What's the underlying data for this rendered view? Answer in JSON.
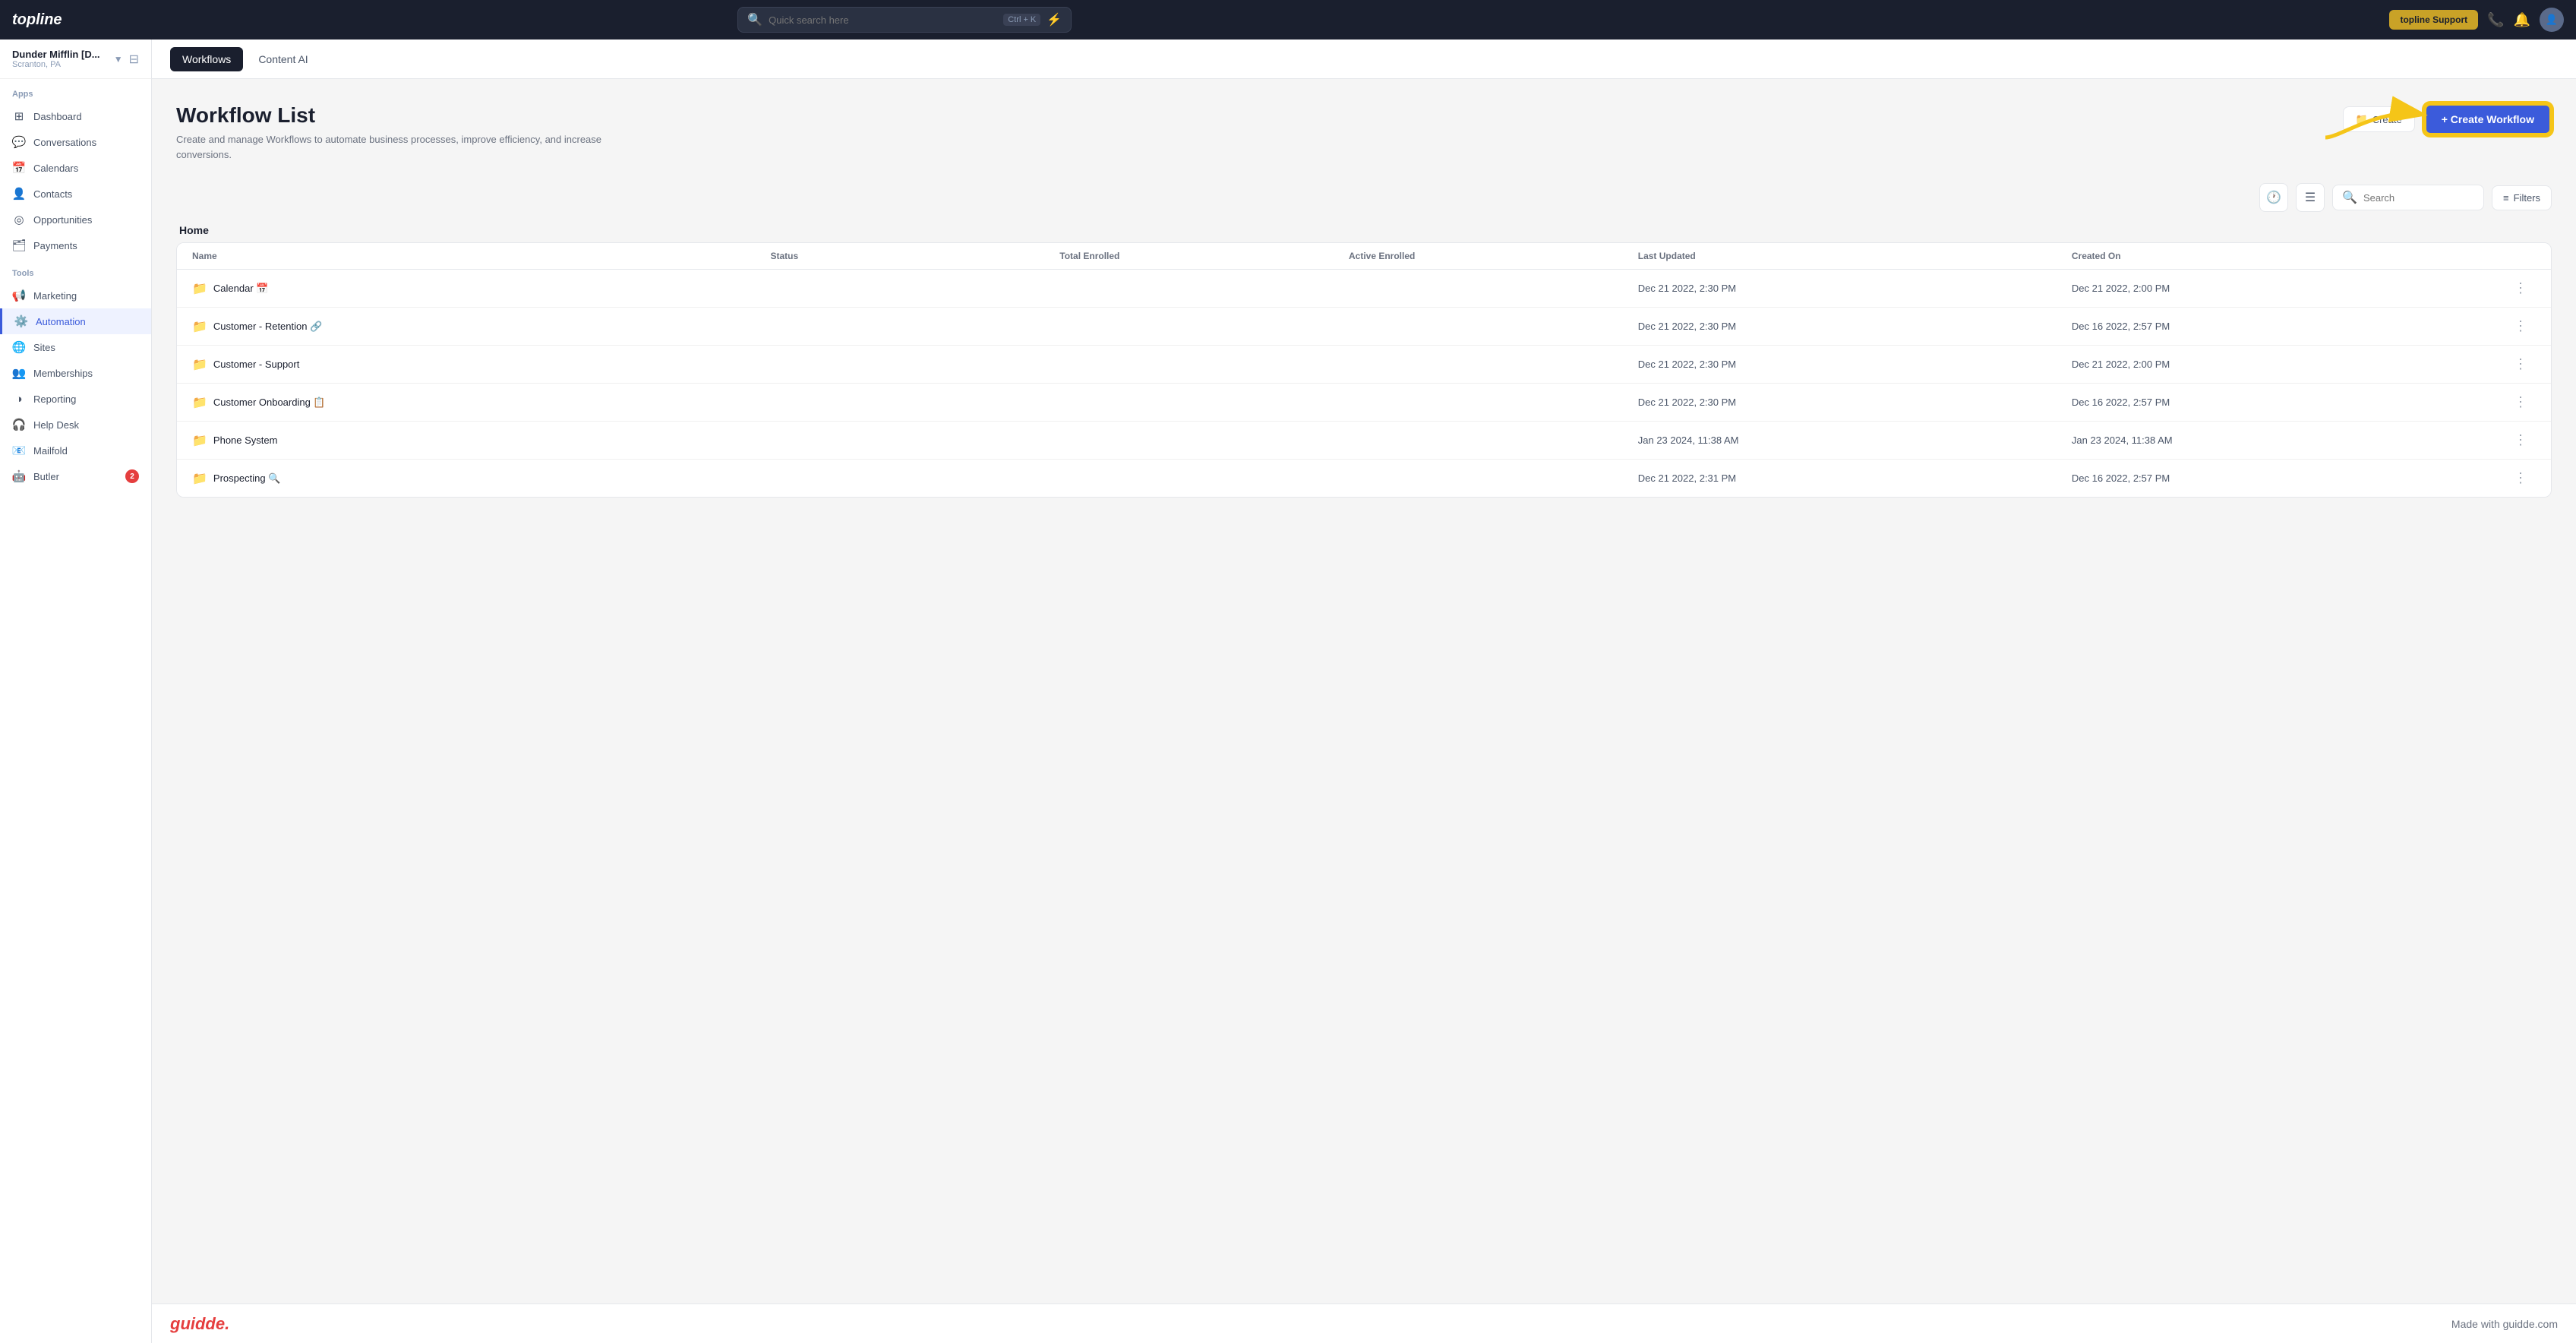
{
  "app": {
    "logo": "topline",
    "search_placeholder": "Quick search here",
    "search_shortcut": "Ctrl + K",
    "lightning_icon": "⚡",
    "support_label": "topline Support"
  },
  "sidebar": {
    "workspace_name": "Dunder Mifflin [D...",
    "workspace_location": "Scranton, PA",
    "apps_label": "Apps",
    "tools_label": "Tools",
    "items_apps": [
      {
        "id": "dashboard",
        "label": "Dashboard",
        "icon": "⊞"
      },
      {
        "id": "conversations",
        "label": "Conversations",
        "icon": "💬"
      },
      {
        "id": "calendars",
        "label": "Calendars",
        "icon": "📅"
      },
      {
        "id": "contacts",
        "label": "Contacts",
        "icon": "👤"
      },
      {
        "id": "opportunities",
        "label": "Opportunities",
        "icon": "◎"
      },
      {
        "id": "payments",
        "label": "Payments",
        "icon": "🗂"
      }
    ],
    "items_tools": [
      {
        "id": "marketing",
        "label": "Marketing",
        "icon": "📢"
      },
      {
        "id": "automation",
        "label": "Automation",
        "icon": "⚙",
        "active": true
      },
      {
        "id": "sites",
        "label": "Sites",
        "icon": "🌐"
      },
      {
        "id": "memberships",
        "label": "Memberships",
        "icon": "👥"
      },
      {
        "id": "reporting",
        "label": "Reporting",
        "icon": "◑"
      },
      {
        "id": "helpdesk",
        "label": "Help Desk",
        "icon": "🎧"
      },
      {
        "id": "mailfold",
        "label": "Mailfold",
        "icon": "📧"
      },
      {
        "id": "butler",
        "label": "Butler",
        "icon": "🤖",
        "badge": "2"
      }
    ]
  },
  "subtabs": [
    {
      "id": "workflows",
      "label": "Workflows",
      "active": true
    },
    {
      "id": "content_ai",
      "label": "Content AI",
      "active": false
    }
  ],
  "page": {
    "title": "Workflow List",
    "description": "Create and manage Workflows to automate business processes, improve efficiency, and increase conversions.",
    "folder_label": "Home",
    "btn_folder_label": "Create",
    "btn_create_label": "+ Create Workflow",
    "search_placeholder": "Search",
    "filters_label": "Filters"
  },
  "table": {
    "columns": [
      "Name",
      "Status",
      "Total Enrolled",
      "Active Enrolled",
      "Last Updated",
      "Created On",
      ""
    ],
    "rows": [
      {
        "name": "Calendar 📅",
        "status": "",
        "total_enrolled": "",
        "active_enrolled": "",
        "last_updated": "Dec 21 2022, 2:30 PM",
        "created_on": "Dec 21 2022, 2:00 PM"
      },
      {
        "name": "Customer - Retention 🔗",
        "status": "",
        "total_enrolled": "",
        "active_enrolled": "",
        "last_updated": "Dec 21 2022, 2:30 PM",
        "created_on": "Dec 16 2022, 2:57 PM"
      },
      {
        "name": "Customer - Support",
        "status": "",
        "total_enrolled": "",
        "active_enrolled": "",
        "last_updated": "Dec 21 2022, 2:30 PM",
        "created_on": "Dec 21 2022, 2:00 PM"
      },
      {
        "name": "Customer Onboarding 📋",
        "status": "",
        "total_enrolled": "",
        "active_enrolled": "",
        "last_updated": "Dec 21 2022, 2:30 PM",
        "created_on": "Dec 16 2022, 2:57 PM"
      },
      {
        "name": "Phone System",
        "status": "",
        "total_enrolled": "",
        "active_enrolled": "",
        "last_updated": "Jan 23 2024, 11:38 AM",
        "created_on": "Jan 23 2024, 11:38 AM"
      },
      {
        "name": "Prospecting 🔍",
        "status": "",
        "total_enrolled": "",
        "active_enrolled": "",
        "last_updated": "Dec 21 2022, 2:31 PM",
        "created_on": "Dec 16 2022, 2:57 PM"
      }
    ]
  },
  "bottom_bar": {
    "logo": "guidde.",
    "text": "Made with guidde.com"
  }
}
